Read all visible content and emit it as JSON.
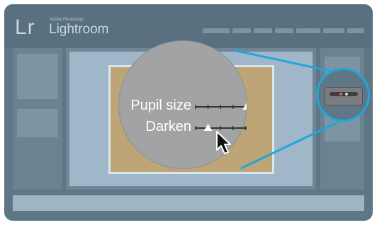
{
  "app": {
    "logo_mark": "Lr",
    "logo_subtitle": "Adobe Photoshop",
    "logo_name": "Lightroom"
  },
  "controls": {
    "pupil_size_label": "Pupil size",
    "pupil_size_value": 0.82,
    "darken_label": "Darken",
    "darken_value": 0.2
  },
  "colors": {
    "accent": "#1da8db",
    "panel": "#5f7684",
    "magnifier": "#a1a3a5"
  },
  "icons": {
    "cursor": "arrow-cursor-icon"
  }
}
